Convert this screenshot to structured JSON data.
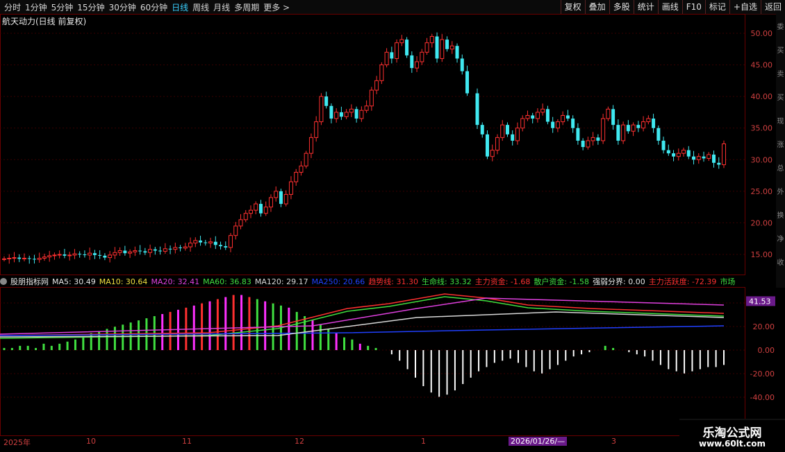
{
  "toolbar": {
    "periods": [
      "分时",
      "1分钟",
      "5分钟",
      "15分钟",
      "30分钟",
      "60分钟",
      "日线",
      "周线",
      "月线",
      "多周期",
      "更多 >"
    ],
    "active": "日线",
    "actions": [
      "复权",
      "叠加",
      "多股",
      "统计",
      "画线",
      "F10",
      "标记",
      "+自选",
      "返回"
    ]
  },
  "main": {
    "title": "航天动力(日线 前复权)",
    "y_ticks": [
      "50.00",
      "45.00",
      "40.00",
      "35.00",
      "30.00",
      "25.00",
      "20.00",
      "15.00"
    ]
  },
  "indicator": {
    "name": "股朋指标网",
    "items": [
      {
        "label": "MA5: 30.49",
        "color": "#e8e8e8"
      },
      {
        "label": "MA10: 30.64",
        "color": "#f0e040"
      },
      {
        "label": "MA20: 32.41",
        "color": "#e040e0"
      },
      {
        "label": "MA60: 36.83",
        "color": "#40e040"
      },
      {
        "label": "MA120: 29.17",
        "color": "#d8d8d8"
      },
      {
        "label": "MA250: 20.66",
        "color": "#2040ff"
      },
      {
        "label": "趋势线: 31.30",
        "color": "#ff3030"
      },
      {
        "label": "生命线: 33.32",
        "color": "#40e040"
      },
      {
        "label": "主力资金: -1.68",
        "color": "#ff3030"
      },
      {
        "label": "散户资金: -1.58",
        "color": "#40e040"
      },
      {
        "label": "强弱分界: 0.00",
        "color": "#e8e8e8"
      },
      {
        "label": "主力活跃度: -72.39",
        "color": "#ff3030"
      },
      {
        "label": "市场",
        "color": "#40e040"
      }
    ],
    "current": "41.53",
    "y_ticks": [
      "40.00",
      "20.00",
      "0.00",
      "-20.00",
      "-40.00"
    ]
  },
  "dates": {
    "labels": [
      "2025年",
      "10",
      "11",
      "12",
      "1",
      "2",
      "3"
    ],
    "cursor": "2026/01/26/—"
  },
  "watermark": {
    "line1": "乐淘公式网",
    "line2": "www.60lt.com"
  },
  "side_text": [
    "委",
    "买",
    "卖",
    "买",
    "现",
    "涨",
    "总",
    "外",
    "换",
    "净",
    "收"
  ],
  "colors": {
    "up": "#ff3030",
    "down": "#40e8f0",
    "bg": "#000000",
    "grid": "#5a0000"
  },
  "chart_data": {
    "type": "candlestick",
    "price_ylim": [
      12,
      52
    ],
    "closes": [
      14.3,
      14.4,
      14.5,
      14.3,
      14.4,
      14.3,
      14.2,
      14.4,
      14.6,
      14.8,
      14.9,
      15.0,
      14.8,
      14.9,
      15.1,
      15.0,
      14.9,
      15.2,
      14.9,
      14.8,
      14.5,
      14.9,
      15.3,
      15.6,
      15.2,
      15.4,
      15.6,
      15.5,
      15.3,
      15.8,
      15.6,
      15.5,
      15.9,
      15.8,
      16.1,
      16.0,
      16.2,
      16.8,
      17.2,
      16.9,
      16.8,
      17.0,
      16.5,
      16.3,
      16.1,
      18.0,
      19.5,
      20.5,
      21.5,
      22.0,
      23.0,
      21.5,
      22.5,
      24.0,
      25.0,
      23.0,
      24.5,
      26.5,
      28.0,
      29.0,
      31.0,
      33.5,
      36.0,
      40.0,
      38.5,
      36.5,
      37.5,
      36.8,
      37.5,
      38.0,
      36.5,
      37.8,
      38.5,
      41.0,
      42.5,
      45.0,
      47.0,
      46.0,
      48.5,
      49.0,
      46.5,
      44.5,
      45.5,
      47.0,
      48.5,
      49.5,
      46.0,
      49.0,
      47.5,
      48.0,
      46.0,
      44.0,
      40.5,
      null,
      35.5,
      34.0,
      30.5,
      31.5,
      33.5,
      35.5,
      34.0,
      33.0,
      35.0,
      36.5,
      37.0,
      36.5,
      37.5,
      38.0,
      36.0,
      35.0,
      36.0,
      37.0,
      36.5,
      35.0,
      33.0,
      32.0,
      33.0,
      33.5,
      33.0,
      36.5,
      38.0,
      35.5,
      33.0,
      35.5,
      34.5,
      35.5,
      35.0,
      36.0,
      36.5,
      35.0,
      33.0,
      31.5,
      31.0,
      30.5,
      31.0,
      31.5,
      30.5,
      30.0,
      30.5,
      30.2,
      30.8,
      29.5,
      29.2,
      32.5
    ],
    "macd": [
      1,
      1,
      2,
      2,
      1,
      3,
      2,
      3,
      4,
      5,
      6,
      8,
      9,
      10,
      11,
      12,
      13,
      14,
      15,
      16,
      17,
      18,
      19,
      20,
      21,
      22,
      23,
      24,
      25,
      26,
      26,
      25,
      24,
      23,
      22,
      21,
      20,
      18,
      16,
      14,
      12,
      10,
      8,
      6,
      5,
      3,
      2,
      1,
      0,
      -2,
      -5,
      -9,
      -13,
      -17,
      -20,
      -22,
      -21,
      -19,
      -16,
      -13,
      -10,
      -8,
      -6,
      -5,
      -4,
      -6,
      -8,
      -10,
      -11,
      -9,
      -7,
      -5,
      -3,
      -2,
      -1,
      0,
      2,
      1,
      0,
      -1,
      -2,
      -3,
      -5,
      -7,
      -9,
      -10,
      -11,
      -10,
      -9,
      -8,
      -8,
      -7
    ]
  }
}
